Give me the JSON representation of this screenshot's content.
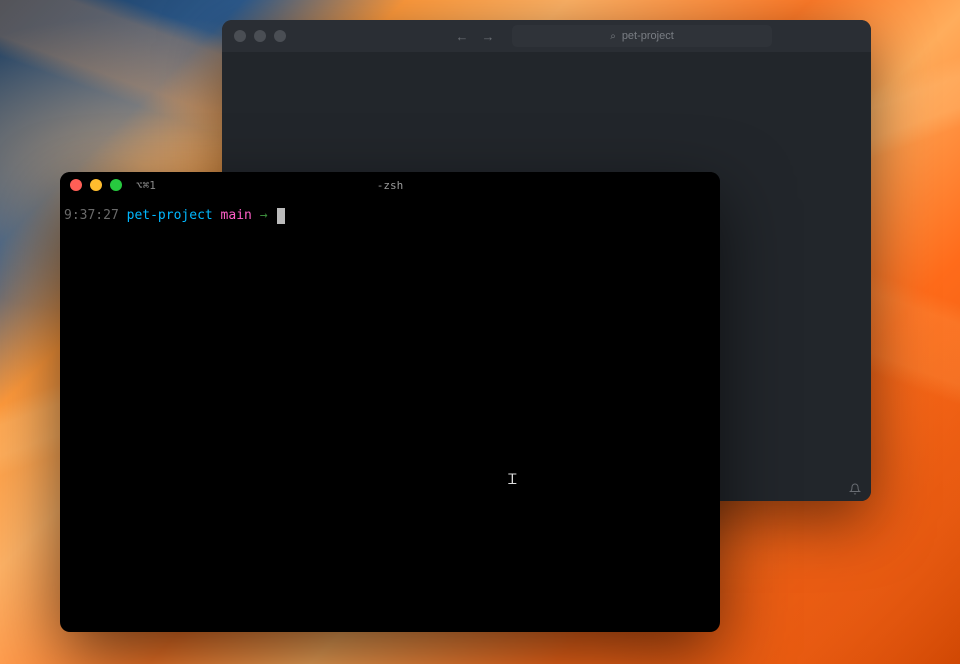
{
  "editor": {
    "search_placeholder": "pet-project",
    "nav_back": "←",
    "nav_forward": "→",
    "search_icon": "⌕",
    "bell_icon": "🔔︎"
  },
  "terminal": {
    "tab_label": "⌥⌘1",
    "title": "-zsh",
    "prompt": {
      "time": "9:37:27",
      "directory": "pet-project",
      "branch": "main",
      "arrow": "→"
    },
    "text_cursor_glyph": "Ꮖ"
  }
}
